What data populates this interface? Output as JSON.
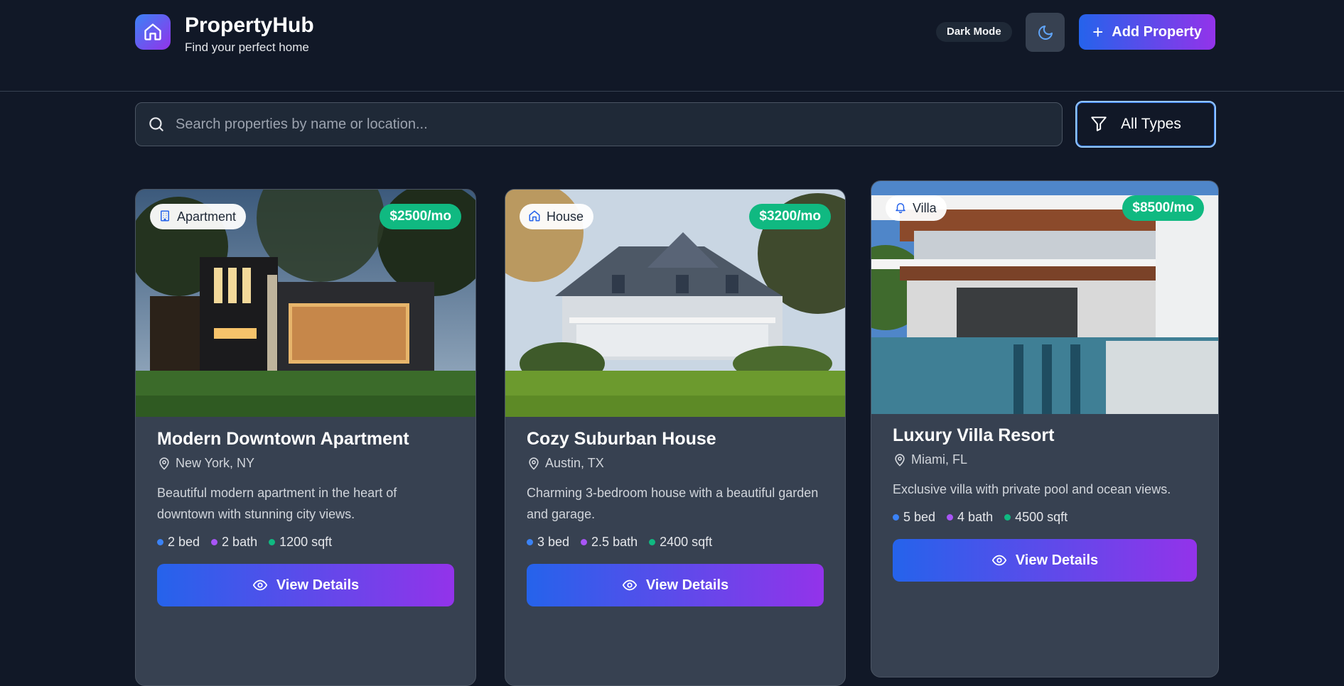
{
  "header": {
    "brand_title": "PropertyHub",
    "brand_subtitle": "Find your perfect home",
    "logo_icon": "home-icon",
    "mode_label": "Dark Mode",
    "theme_toggle_icon": "moon-icon",
    "add_button_label": "Add Property",
    "add_button_icon": "plus-icon"
  },
  "search": {
    "placeholder": "Search properties by name or location...",
    "value": "",
    "icon": "search-icon"
  },
  "filter": {
    "selected": "All Types",
    "icon": "filter-icon"
  },
  "cards": [
    {
      "type_label": "Apartment",
      "type_icon": "building-icon",
      "price": "$2500/mo",
      "title": "Modern Downtown Apartment",
      "location": "New York, NY",
      "description": "Beautiful modern apartment in the heart of downtown with stunning city views.",
      "beds": "2 bed",
      "baths": "2 bath",
      "area": "1200 sqft",
      "button_label": "View Details"
    },
    {
      "type_label": "House",
      "type_icon": "home-icon",
      "price": "$3200/mo",
      "title": "Cozy Suburban House",
      "location": "Austin, TX",
      "description": "Charming 3-bedroom house with a beautiful garden and garage.",
      "beds": "3 bed",
      "baths": "2.5 bath",
      "area": "2400 sqft",
      "button_label": "View Details"
    },
    {
      "type_label": "Villa",
      "type_icon": "bell-icon",
      "price": "$8500/mo",
      "title": "Luxury Villa Resort",
      "location": "Miami, FL",
      "description": "Exclusive villa with private pool and ocean views.",
      "beds": "5 bed",
      "baths": "4 bath",
      "area": "4500 sqft",
      "button_label": "View Details"
    }
  ],
  "colors": {
    "background": "#111827",
    "card": "#374151",
    "accent_start": "#2563eb",
    "accent_end": "#9333ea",
    "price_badge": "#10b981",
    "bed_dot": "#3b82f6",
    "bath_dot": "#a855f7",
    "area_dot": "#10b981"
  }
}
